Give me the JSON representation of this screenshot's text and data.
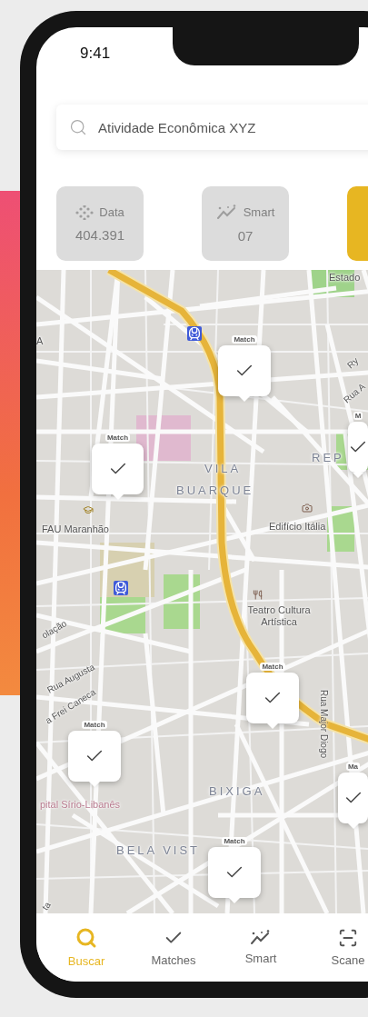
{
  "status_bar": {
    "time": "9:41"
  },
  "search": {
    "value": "Atividade Econômica XYZ"
  },
  "cards": [
    {
      "kind": "data",
      "label": "Data",
      "value": "404.391",
      "selected": false
    },
    {
      "kind": "smart",
      "label": "Smart",
      "value": "07",
      "selected": false
    },
    {
      "kind": "blank",
      "selected": true
    }
  ],
  "map": {
    "labels": [
      {
        "kind": "place",
        "text": "Estado"
      },
      {
        "kind": "place",
        "text": "A"
      },
      {
        "kind": "district",
        "text": "VILA"
      },
      {
        "kind": "district",
        "text": "BUARQUE"
      },
      {
        "kind": "district",
        "text": "REP"
      },
      {
        "kind": "place",
        "text": "FAU Maranhão"
      },
      {
        "kind": "place",
        "text": "Edifício Itália"
      },
      {
        "kind": "place",
        "text": "Teatro Cultura Artística"
      },
      {
        "kind": "street",
        "text": "olação"
      },
      {
        "kind": "street",
        "text": "Rua Augusta"
      },
      {
        "kind": "street",
        "text": "a Frei Caneca"
      },
      {
        "kind": "street",
        "text": "Rua Major Diogo"
      },
      {
        "kind": "district",
        "text": "BIXIGA"
      },
      {
        "kind": "hospital",
        "text": "pital Sírio-Libanês"
      },
      {
        "kind": "district",
        "text": "BELA VIST"
      },
      {
        "kind": "street",
        "text": "Ry"
      },
      {
        "kind": "street",
        "text": "Rua A"
      },
      {
        "kind": "street",
        "text": "ta"
      }
    ],
    "markers": [
      {
        "label": "Match"
      },
      {
        "label": "Match"
      },
      {
        "label": "Match"
      },
      {
        "label": "Match"
      },
      {
        "label": "Match"
      },
      {
        "label": "M"
      },
      {
        "label": "Ma"
      }
    ]
  },
  "nav": [
    {
      "kind": "search",
      "label": "Buscar",
      "selected": true
    },
    {
      "kind": "check",
      "label": "Matches",
      "selected": false
    },
    {
      "kind": "smart",
      "label": "Smart",
      "selected": false
    },
    {
      "kind": "scan",
      "label": "Scane",
      "selected": false
    }
  ]
}
